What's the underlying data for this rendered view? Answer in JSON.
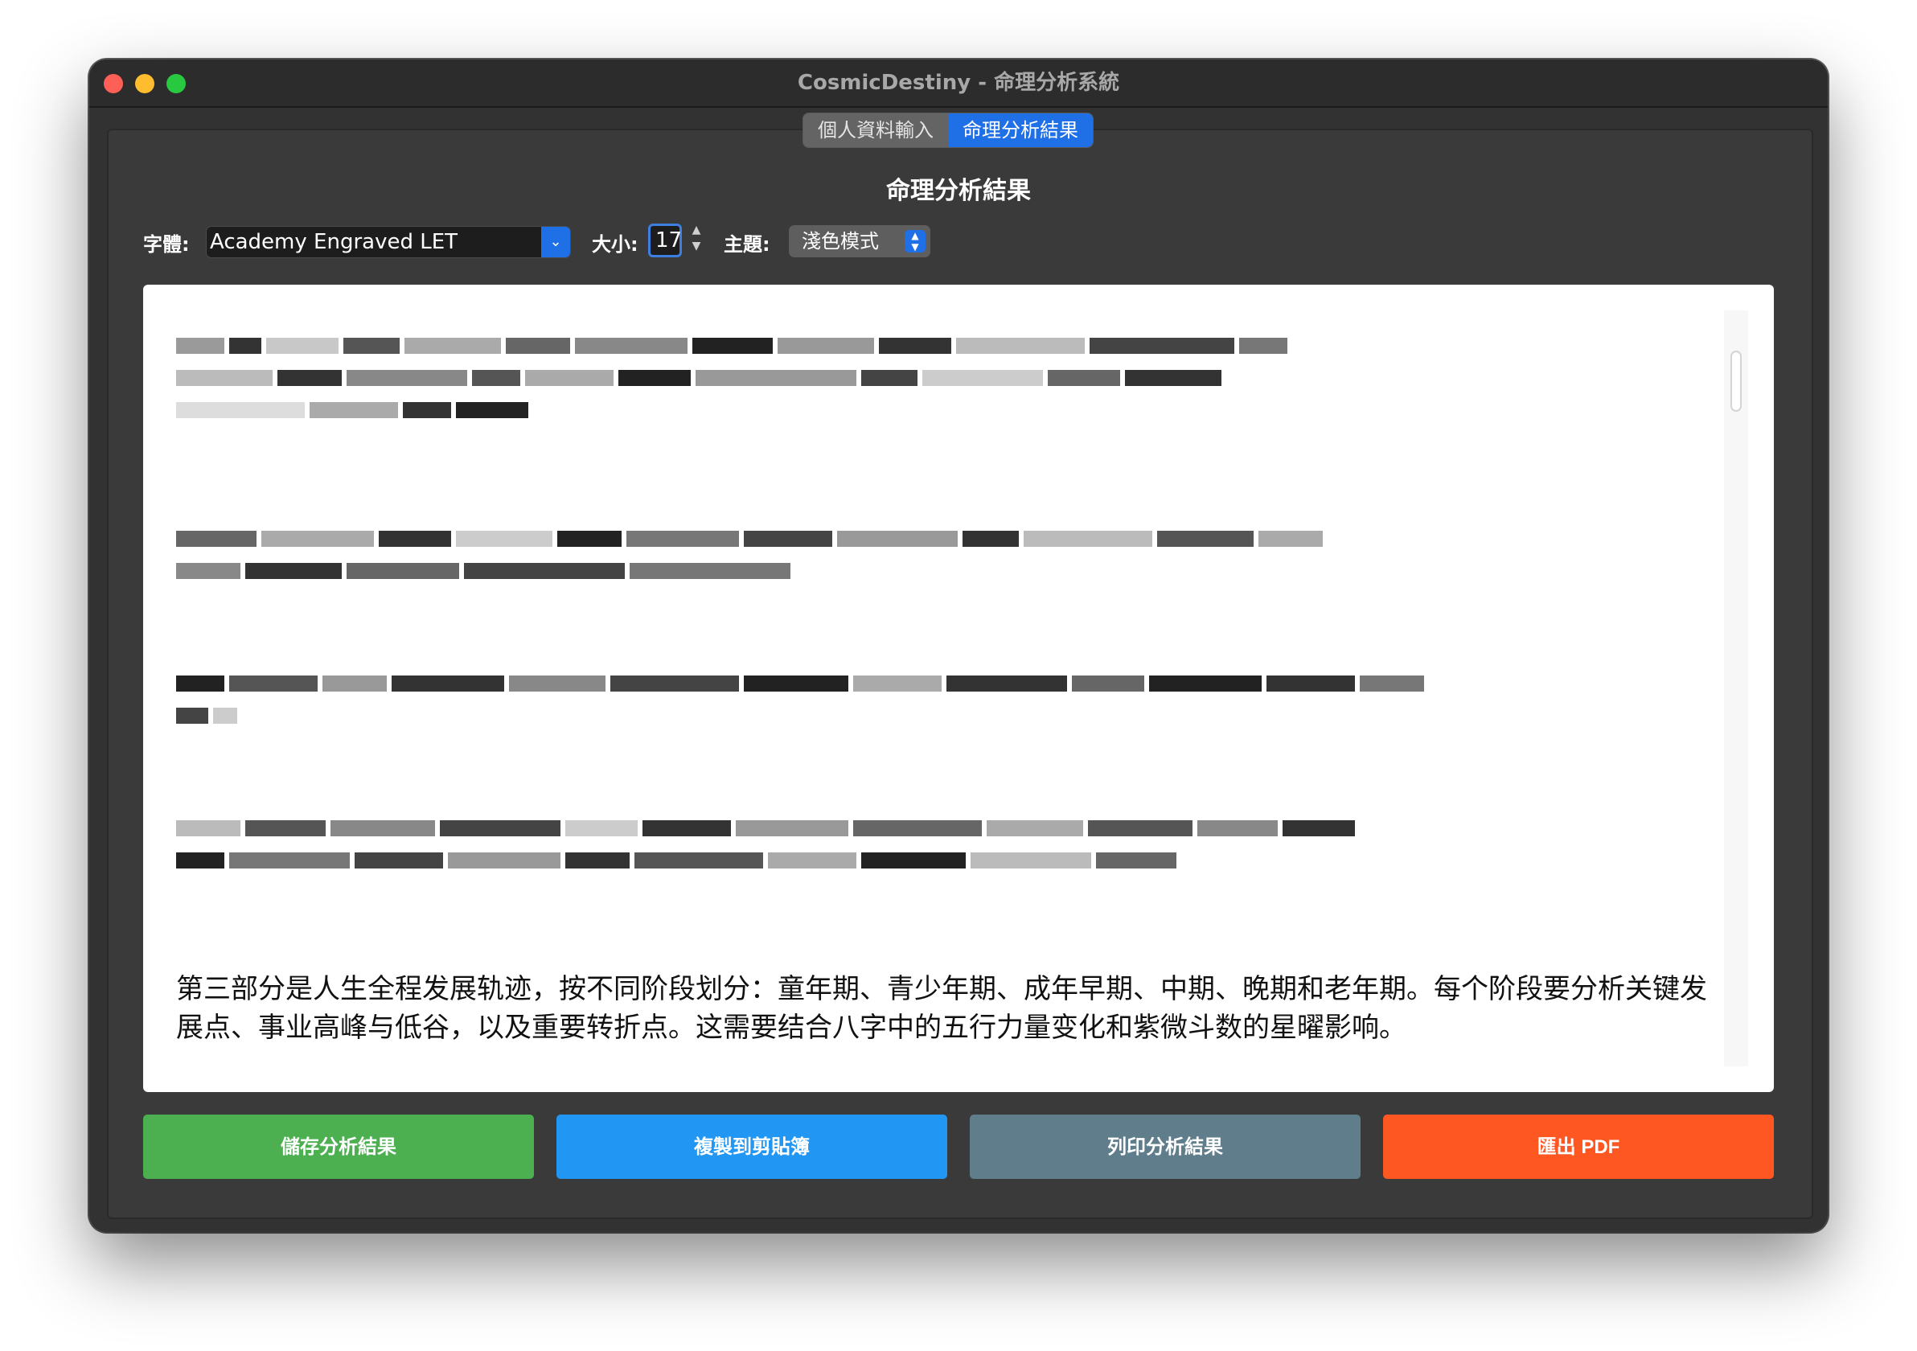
{
  "window": {
    "title": "CosmicDestiny - 命理分析系統"
  },
  "tabs": [
    {
      "label": "個人資料輸入",
      "active": false
    },
    {
      "label": "命理分析結果",
      "active": true
    }
  ],
  "page": {
    "heading": "命理分析結果"
  },
  "controls": {
    "font_label": "字體:",
    "font_value": "Academy Engraved LET",
    "size_label": "大小:",
    "size_value": "17",
    "theme_label": "主題:",
    "theme_value": "淺色模式"
  },
  "result": {
    "visible_paragraph": "第三部分是人生全程发展轨迹，按不同阶段划分：童年期、青少年期、成年早期、中期、晚期和老年期。每个阶段要分析关键发展点、事业高峰与低谷，以及重要转折点。这需要结合八字中的五行力量变化和紫微斗数的星曜影响。"
  },
  "buttons": {
    "save": "儲存分析結果",
    "copy": "複製到剪貼簿",
    "print": "列印分析結果",
    "pdf": "匯出 PDF"
  },
  "colors": {
    "accent": "#1f6fe6",
    "save": "#4caf50",
    "copy": "#2196f3",
    "print": "#607d8b",
    "pdf": "#ff5722"
  }
}
